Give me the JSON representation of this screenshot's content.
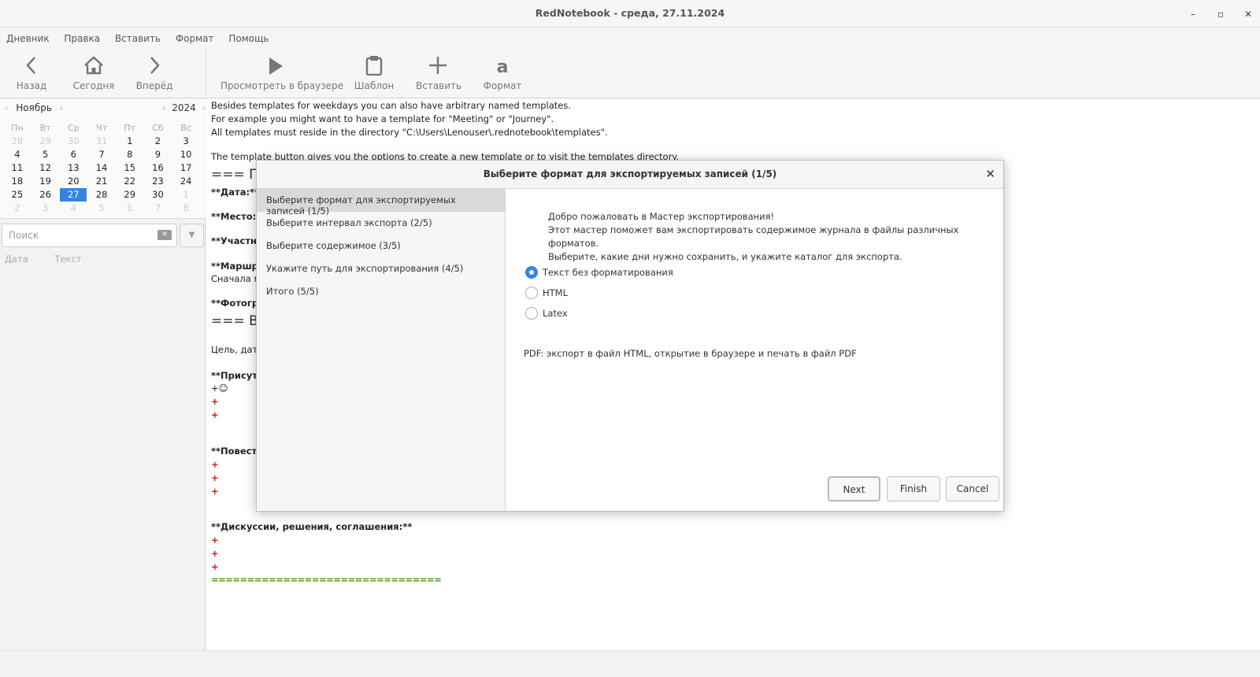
{
  "window": {
    "title": "RedNotebook - среда, 27.11.2024",
    "minimize": "–",
    "maximize": "▫",
    "close": "✕"
  },
  "menu": [
    "Дневник",
    "Правка",
    "Вставить",
    "Формат",
    "Помощь"
  ],
  "toolbar": {
    "back": "Назад",
    "today": "Сегодня",
    "forward": "Вперёд",
    "preview": "Просмотреть в браузере",
    "template": "Шаблон",
    "insert": "Вставить",
    "format": "Формат"
  },
  "calendar": {
    "month": "Ноябрь",
    "year": "2024",
    "weekdays": [
      "Пн",
      "Вт",
      "Ср",
      "Чт",
      "Пт",
      "Сб",
      "Вс"
    ],
    "weeks": [
      [
        "28",
        "29",
        "30",
        "31",
        "1",
        "2",
        "3"
      ],
      [
        "4",
        "5",
        "6",
        "7",
        "8",
        "9",
        "10"
      ],
      [
        "11",
        "12",
        "13",
        "14",
        "15",
        "16",
        "17"
      ],
      [
        "18",
        "19",
        "20",
        "21",
        "22",
        "23",
        "24"
      ],
      [
        "25",
        "26",
        "27",
        "28",
        "29",
        "30",
        "1"
      ],
      [
        "2",
        "3",
        "4",
        "5",
        "6",
        "7",
        "8"
      ]
    ],
    "selected_day": "27"
  },
  "search": {
    "placeholder": "Поиск",
    "col_date": "Дата",
    "col_text": "Текст"
  },
  "editor": {
    "line1": "Besides templates for weekdays you can also have arbitrary named templates.",
    "line2": "For example you might want to have a template for \"Meeting\" or \"Journey\".",
    "line3": "All templates must reside in the directory \"C:\\Users\\Lenouser\\.rednotebook\\templates\".",
    "line4": "The template button gives you the options to create a new template or to visit the templates directory.",
    "heading1": "=== П",
    "date": "**Дата:**",
    "place": "**Место:**",
    "participants": "**Участни",
    "route": "**Маршру",
    "route_text": "Сначала м",
    "photos": "**Фотогра",
    "heading2": "=== В",
    "goal": "Цель, дата",
    "present": "**Присутс",
    "plus_smiley": "+☺",
    "plus": "+",
    "agenda": "**Повестка",
    "discussions": "**Дискуссии, решения, соглашения:**",
    "separator": "================================"
  },
  "dialog": {
    "title": "Выберите формат для экспортируемых записей (1/5)",
    "close": "✕",
    "steps": [
      "Выберите формат для экспортируемых записей (1/5)",
      "Выберите интервал экспорта (2/5)",
      "Выберите содержимое (3/5)",
      "Укажите путь для экспортирования (4/5)",
      "Итого (5/5)"
    ],
    "intro": [
      "Добро пожаловать в Мастер экспортирования!",
      "Этот мастер поможет вам экспортировать содержимое журнала в файлы различных форматов.",
      "Выберите, какие дни нужно сохранить, и укажите каталог для экспорта."
    ],
    "formats": [
      "Текст без форматирования",
      "HTML",
      "Latex"
    ],
    "selected_format": "Текст без форматирования",
    "pdf_note": "PDF: экспорт в файл HTML, открытие в браузере и печать в файл PDF",
    "buttons": {
      "next": "Next",
      "finish": "Finish",
      "cancel": "Cancel"
    }
  },
  "colors": {
    "accent": "#3584e4",
    "plus_red": "#dd1111",
    "separator_green": "#3c9a1c"
  }
}
